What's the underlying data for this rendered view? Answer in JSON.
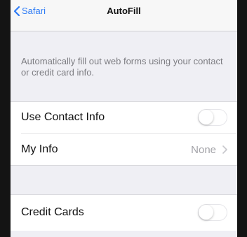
{
  "navbar": {
    "back_label": "Safari",
    "title": "AutoFill"
  },
  "description": "Automatically fill out web forms using your contact or credit card info.",
  "rows": {
    "use_contact_info": {
      "label": "Use Contact Info",
      "toggle_on": false
    },
    "my_info": {
      "label": "My Info",
      "value": "None"
    },
    "credit_cards": {
      "label": "Credit Cards",
      "toggle_on": false
    }
  },
  "colors": {
    "accent": "#2f7cf6",
    "grouped_background": "#efeff4"
  },
  "icons": {
    "back": "chevron-left-icon",
    "disclosure": "chevron-right-icon"
  }
}
